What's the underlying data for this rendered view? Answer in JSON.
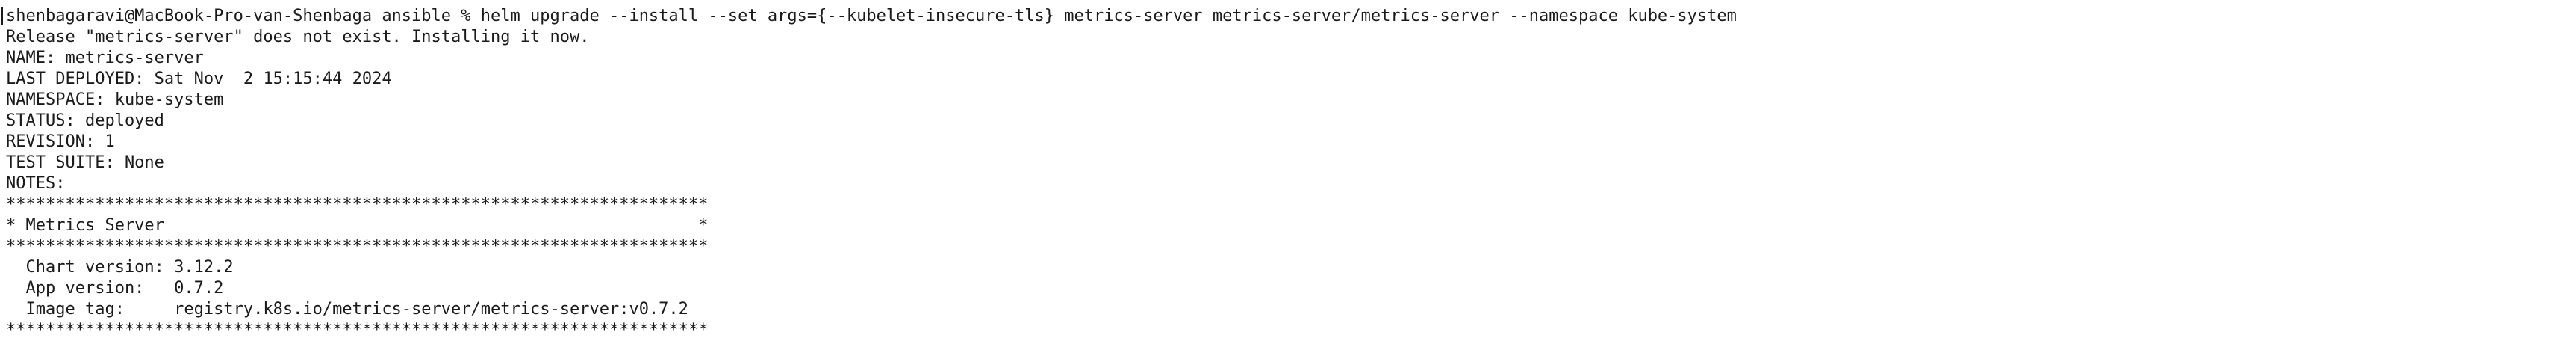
{
  "terminal": {
    "prompt": "shenbagaravi@MacBook-Pro-van-Shenbaga ansible % ",
    "command": "helm upgrade --install --set args={--kubelet-insecure-tls} metrics-server metrics-server/metrics-server --namespace kube-system",
    "output_lines": [
      "Release \"metrics-server\" does not exist. Installing it now.",
      "NAME: metrics-server",
      "LAST DEPLOYED: Sat Nov  2 15:15:44 2024",
      "NAMESPACE: kube-system",
      "STATUS: deployed",
      "REVISION: 1",
      "TEST SUITE: None",
      "NOTES:",
      "***********************************************************************",
      "* Metrics Server                                                      *",
      "***********************************************************************",
      "  Chart version: 3.12.2",
      "  App version:   0.7.2",
      "  Image tag:     registry.k8s.io/metrics-server/metrics-server:v0.7.2",
      "***********************************************************************"
    ]
  }
}
